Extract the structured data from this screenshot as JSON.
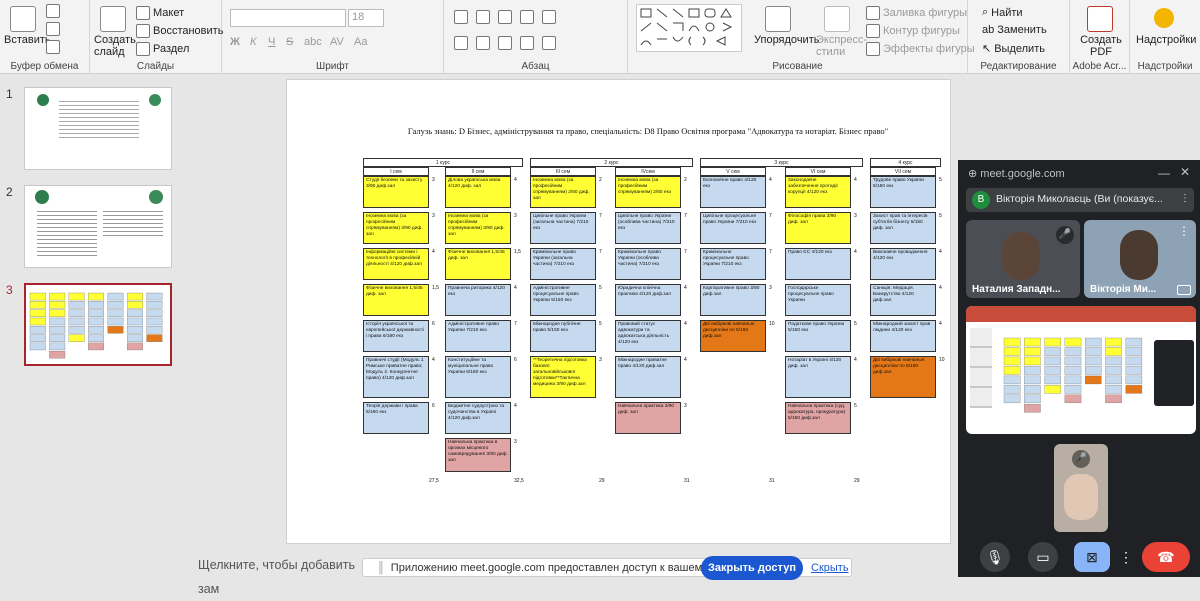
{
  "ribbon": {
    "clipboard": {
      "paste": "Вставить",
      "label": "Буфер обмена"
    },
    "slides": {
      "new_slide": "Создать слайд",
      "layout": "Макет",
      "reset": "Восстановить",
      "section": "Раздел",
      "label": "Слайды"
    },
    "font": {
      "size": "18",
      "label": "Шрифт",
      "bold": "Ж",
      "italic": "К",
      "underline": "Ч",
      "strike": "S",
      "shadow": "abc",
      "spacing": "AV",
      "case": "Aa"
    },
    "paragraph": {
      "label": "Абзац"
    },
    "drawing": {
      "arrange": "Упорядочить",
      "quick_styles": "Экспресс-стили",
      "fill": "Заливка фигуры",
      "outline": "Контур фигуры",
      "effects": "Эффекты фигуры",
      "label": "Рисование"
    },
    "editing": {
      "find": "Найти",
      "replace": "Заменить",
      "select": "Выделить",
      "label": "Редактирование"
    },
    "pdf": {
      "create": "Создать PDF",
      "label": "Adobe Acr..."
    },
    "addins": {
      "addins": "Надстройки",
      "label": "Надстройки"
    }
  },
  "slides_panel": {
    "items": [
      {
        "num": "1"
      },
      {
        "num": "2"
      },
      {
        "num": "3"
      }
    ]
  },
  "slide": {
    "title": "Галузь знань: D Бізнес, адміністрування та право, спеціальність: D8 Право  Освітня програма \"Адвокатура та нотаріат. Бізнес право\"",
    "courses": [
      "1 курс",
      "2 курс",
      "3 курс",
      "4 курс"
    ],
    "semesters": [
      "I сем",
      "II сем",
      "III сем",
      "IVсем",
      "V сем",
      "VI сем",
      "VII сем",
      "VIII сем"
    ],
    "cells": [
      {
        "t": "Студії безпеки та захисту 3/90 диф.зал",
        "c": "y",
        "col": 0,
        "row": 0,
        "n": "3"
      },
      {
        "t": "Іноземна мова (за професійним спрямуванням) 3/90 диф. зал",
        "c": "y",
        "col": 0,
        "row": 1,
        "n": "3"
      },
      {
        "t": "Інформаційні системи і технології в професійній діяльності 4/120 диф.зал",
        "c": "y",
        "col": 0,
        "row": 2,
        "n": "4"
      },
      {
        "t": "Фізичне виховання 1,5/45 диф. зал",
        "c": "y",
        "col": 0,
        "row": 3,
        "n": "1,5"
      },
      {
        "t": "Історія української та європейської державності і права 6/180 екз",
        "c": "b",
        "col": 0,
        "row": 4,
        "n": "6"
      },
      {
        "t": "Правничі студії (Модуль 1 Римське приватне право; Модуль 2. Конкурентне право) 4/120 диф.зал",
        "c": "b",
        "col": 0,
        "row": 5,
        "n": "4"
      },
      {
        "t": "Теорія держави і права 6/180 екз",
        "c": "b",
        "col": 0,
        "row": 6,
        "n": "6"
      },
      {
        "t": "Ділова українська мова 4/120 диф. зал",
        "c": "y",
        "col": 1,
        "row": 0,
        "n": "4"
      },
      {
        "t": "Іноземна мова (за професійним спрямуванням) 3/90 диф. зал",
        "c": "y",
        "col": 1,
        "row": 1,
        "n": "3"
      },
      {
        "t": "Фізичне виховання 1,5/45 диф. зал",
        "c": "y",
        "col": 1,
        "row": 2,
        "n": "1,5"
      },
      {
        "t": "Правнича риторика 4/120 екз",
        "c": "b",
        "col": 1,
        "row": 3,
        "n": "4"
      },
      {
        "t": "Адміністративне право України 7/210 екз",
        "c": "b",
        "col": 1,
        "row": 4,
        "n": "7"
      },
      {
        "t": "Конституційне та муніципальне право України 6/180 екз",
        "c": "b",
        "col": 1,
        "row": 5,
        "n": "6"
      },
      {
        "t": "Бюджетне судоустрою та судочинства в Україні 4/120 диф.зал",
        "c": "b",
        "col": 1,
        "row": 6,
        "n": "4"
      },
      {
        "t": "Навчальна практика в органах місцевого самоврядування 3/90 диф. зал",
        "c": "r",
        "col": 1,
        "row": 7,
        "n": "3"
      },
      {
        "t": "Іноземна мова (за професійним спрямуванням) 2/60 диф. зал",
        "c": "y",
        "col": 2,
        "row": 0,
        "n": "2"
      },
      {
        "t": "Цивільне право України (загальна частина) 7/210 екз",
        "c": "b",
        "col": 2,
        "row": 1,
        "n": "7"
      },
      {
        "t": "Кримінальне право України (загальна частина) 7/210 екз",
        "c": "b",
        "col": 2,
        "row": 2,
        "n": "7"
      },
      {
        "t": "Адміністративне процесуальне право України 5/150 екз",
        "c": "b",
        "col": 2,
        "row": 3,
        "n": "5"
      },
      {
        "t": "Міжнародне публічне право 5/150 екз",
        "c": "b",
        "col": 2,
        "row": 4,
        "n": "5"
      },
      {
        "t": "**Теоретична підготовка базової загальновійськової підготовки**Тактична медицина 3/90 диф.зал",
        "c": "y",
        "col": 2,
        "row": 5,
        "n": "3"
      },
      {
        "t": "Іноземна мова (за професійним спрямуванням) 2/60 екз",
        "c": "y",
        "col": 3,
        "row": 0,
        "n": "2"
      },
      {
        "t": "Цивільне право України (особлива частина) 7/210 екз",
        "c": "b",
        "col": 3,
        "row": 1,
        "n": "7"
      },
      {
        "t": "Кримінальне право України (особлива частина) 7/210 екз",
        "c": "b",
        "col": 3,
        "row": 2,
        "n": "7"
      },
      {
        "t": "Юридична клінічна практика 4/120 диф.зал",
        "c": "b",
        "col": 3,
        "row": 3,
        "n": "4"
      },
      {
        "t": "Правовий статус адвокатури та адвокатська діяльність 4/120 екз",
        "c": "b",
        "col": 3,
        "row": 4,
        "n": "4"
      },
      {
        "t": "Міжнародне приватне право 4/120 диф.зал",
        "c": "b",
        "col": 3,
        "row": 5,
        "n": "4"
      },
      {
        "t": "Навчальна практика 3/90 диф. зал",
        "c": "r",
        "col": 3,
        "row": 6,
        "n": "3"
      },
      {
        "t": "Економічне право 4/120 екз",
        "c": "b",
        "col": 4,
        "row": 0,
        "n": "4"
      },
      {
        "t": "Цивільне процесуальне право України 7/210 екз",
        "c": "b",
        "col": 4,
        "row": 1,
        "n": "7"
      },
      {
        "t": "Кримінальне процесуальне право України 7/210 екз",
        "c": "b",
        "col": 4,
        "row": 2,
        "n": "7"
      },
      {
        "t": "Корпоративне право 3/90 диф.зал",
        "c": "b",
        "col": 4,
        "row": 3,
        "n": "3"
      },
      {
        "t": "Дві вибіркові навчальні дисципліни по 5/150 диф.зал",
        "c": "o",
        "col": 4,
        "row": 4,
        "n": "10"
      },
      {
        "t": "Законодавче забезпечення протидії корупції 4/120 екз",
        "c": "y",
        "col": 5,
        "row": 0,
        "n": "4"
      },
      {
        "t": "Філософія права 3/90 диф. зал",
        "c": "y",
        "col": 5,
        "row": 1,
        "n": "3"
      },
      {
        "t": "Право ЄС 4/120 екз",
        "c": "b",
        "col": 5,
        "row": 2,
        "n": "4"
      },
      {
        "t": "Господарське процесуальне право України",
        "c": "b",
        "col": 5,
        "row": 3,
        "n": ""
      },
      {
        "t": "Податкове право України 5/150 екз",
        "c": "b",
        "col": 5,
        "row": 4,
        "n": "5"
      },
      {
        "t": "Нотаріат в Україні 4/120 диф. зал",
        "c": "b",
        "col": 5,
        "row": 5,
        "n": "4"
      },
      {
        "t": "Навчальна практика (суд, адвокатура, прокуратура) 5/150 диф.зал",
        "c": "r",
        "col": 5,
        "row": 6,
        "n": "5"
      },
      {
        "t": "Трудове право України 5/150 екз",
        "c": "b",
        "col": 6,
        "row": 0,
        "n": "5"
      },
      {
        "t": "Захист прав та інтересів суб'єктів бізнесу 5/150 диф. зал",
        "c": "b",
        "col": 6,
        "row": 1,
        "n": "5"
      },
      {
        "t": "Виконавче провадження 4/120 екз",
        "c": "b",
        "col": 6,
        "row": 2,
        "n": "4"
      },
      {
        "t": "Санкція. Медіація. Банкрутство 4/120 диф.зал",
        "c": "b",
        "col": 6,
        "row": 3,
        "n": "4"
      },
      {
        "t": "Міжнародний захист прав людини 4/120 екз",
        "c": "b",
        "col": 6,
        "row": 4,
        "n": "4"
      },
      {
        "t": "Дві вибіркові навчальні дисципліни по 5/150 диф.зал",
        "c": "o",
        "col": 6,
        "row": 5,
        "n": "10"
      }
    ],
    "totals": [
      "27,5",
      "32,5",
      "29",
      "31",
      "31",
      "29"
    ]
  },
  "notes": {
    "placeholder": "Щелкните, чтобы добавить зам"
  },
  "share_bar": {
    "message": "Приложению meet.google.com предоставлен доступ к вашему экрану.",
    "stop": "Закрыть доступ",
    "hide": "Скрыть"
  },
  "meet": {
    "url": "meet.google.com",
    "presenter_initial": "В",
    "presenter": "Вікторія Миколаєць (Ви (показує...",
    "tiles": [
      {
        "name": "Наталия Западн..."
      },
      {
        "name": "Вікторія Ми..."
      }
    ]
  },
  "colors": {
    "yellow": "#ffff33",
    "blue": "#c5d9ef",
    "orange": "#e47818",
    "pink": "#e0a4a4",
    "accent": "#1a57d0",
    "hangup": "#ea4335"
  }
}
